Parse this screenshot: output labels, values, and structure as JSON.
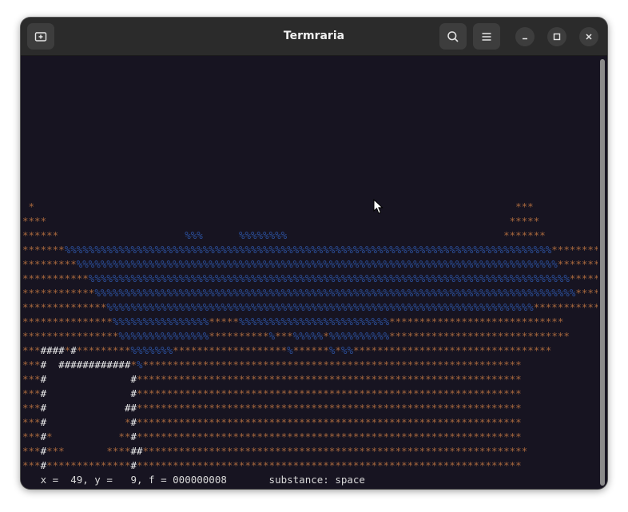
{
  "window": {
    "title": "Termraria"
  },
  "header": {
    "new_tab_icon": "new-tab-icon",
    "search_icon": "search-icon",
    "menu_icon": "hamburger-menu-icon",
    "minimize_icon": "minimize-icon",
    "maximize_icon": "maximize-icon",
    "close_icon": "close-icon"
  },
  "terminal": {
    "blank_rows": 10,
    "rows": [
      " *                                                                                ***",
      "****                                                                             *****",
      "******                     %%%      %%%%%%%%                                    *******",
      "*******%%%%%%%%%%%%%%%%%%%%%%%%%%%%%%%%%%%%%%%%%%%%%%%%%%%%%%%%%%%%%%%%%%%%%%%%%%%%%%%%%*********",
      "*********%%%%%%%%%%%%%%%%%%%%%%%%%%%%%%%%%%%%%%%%%%%%%%%%%%%%%%%%%%%%%%%%%%%%%%%%%%%%%%%%*********",
      "***********%%%%%%%%%%%%%%%%%%%%%%%%%%%%%%%%%%%%%%%%%%%%%%%%%%%%%%%%%%%%%%%%%%%%%%%%%%%%%%%%********",
      "************%%%%%%%%%%%%%%%%%%%%%%%%%%%%%%%%%%%%%%%%%%%%%%%%%%%%%%%%%%%%%%%%%%%%%%%%%%%%%%%%********",
      "**************%%%%%%%%%%%%%%%%%%%%%%%%%%%%%%%%%%%%%%%%%%%%%%%%%%%%%%%%%%%%%%%%%%%%%%%*************",
      "***************%%%%%%%%%%%%%%%%*****%%%%%%%%%%%%%%%%%%%%%%%%%*****************************",
      "****************%%%%%%%%%%%%%%%**********%***%%%%%*%%%%%%%%%%******************************",
      "***####*#*********%%%%%%%*******************%******%*%%*********************************",
      "***#  ############*%***************************************************************",
      "***#              #****************************************************************",
      "***#              #****************************************************************",
      "***#             ##****************************************************************",
      "***#             *#****************************************************************",
      "***#*           **#****************************************************************",
      "***#***       ****##****************************************************************",
      "***#**************#****************************************************************"
    ],
    "status_line": "   x =  49, y =   9, f = 000000008       substance: space"
  },
  "colors": {
    "terminal_bg": "#171421",
    "dirt": "#a8683d",
    "water": "#2b4f9a",
    "structure": "#ececec",
    "status_text": "#d9d9d9",
    "titlebar": "#2b2b2b"
  }
}
